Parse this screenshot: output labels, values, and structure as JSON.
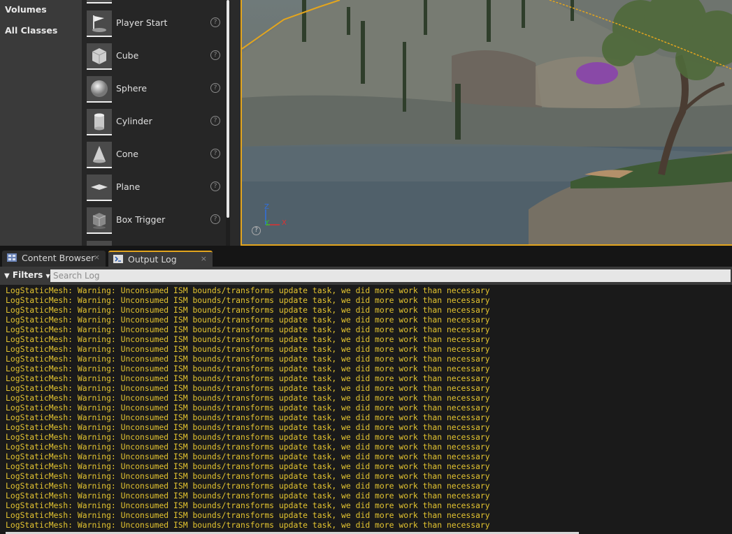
{
  "categories": [
    "Volumes",
    "All Classes"
  ],
  "places": [
    {
      "label": "Player Start",
      "icon": "flag-icon"
    },
    {
      "label": "Cube",
      "icon": "cube-icon"
    },
    {
      "label": "Sphere",
      "icon": "sphere-icon"
    },
    {
      "label": "Cylinder",
      "icon": "cylinder-icon"
    },
    {
      "label": "Cone",
      "icon": "cone-icon"
    },
    {
      "label": "Plane",
      "icon": "plane-icon"
    },
    {
      "label": "Box Trigger",
      "icon": "box-trigger-icon"
    }
  ],
  "viewport": {
    "axis_labels": {
      "z": "Z",
      "y": "Y",
      "x": "X"
    },
    "colors": {
      "selection": "#e3a51e",
      "axis_x": "#e03030",
      "axis_y": "#30c030",
      "axis_z": "#3070e0"
    }
  },
  "tabs": [
    {
      "label": "Content Browser",
      "close": "×",
      "active": false
    },
    {
      "label": "Output Log",
      "close": "×",
      "active": true
    }
  ],
  "filterbar": {
    "filters_label": "Filters",
    "search_placeholder": "Search Log"
  },
  "log": {
    "line_text": "LogStaticMesh: Warning: Unconsumed ISM bounds/transforms update task, we did more work than necessary",
    "line_count": 25,
    "color": "#e4c430"
  }
}
